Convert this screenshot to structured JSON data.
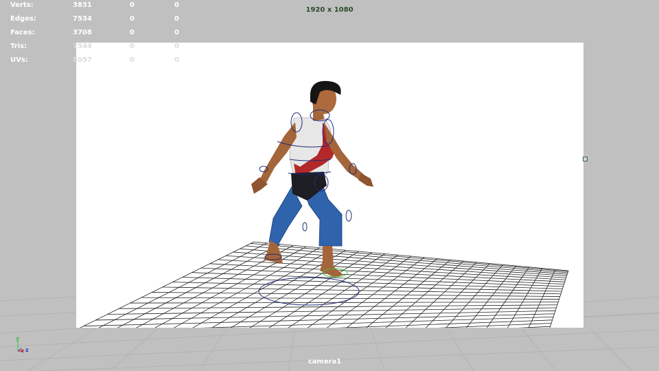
{
  "hud": {
    "rows": [
      {
        "label": "Verts:",
        "v1": "3831",
        "v2": "0",
        "v3": "0"
      },
      {
        "label": "Edges:",
        "v1": "7534",
        "v2": "0",
        "v3": "0"
      },
      {
        "label": "Faces:",
        "v1": "3708",
        "v2": "0",
        "v3": "0"
      },
      {
        "label": "Tris:",
        "v1": "7544",
        "v2": "0",
        "v3": "0"
      },
      {
        "label": "UVs:",
        "v1": "8057",
        "v2": "0",
        "v3": "0"
      }
    ]
  },
  "resolution_label": "1920 x 1080",
  "camera_label": "camera1",
  "axis": {
    "y": "y",
    "x": "x",
    "z": "z"
  },
  "colors": {
    "viewport_bg": "#c0c0c0",
    "gate_bg": "#ffffff",
    "grid_line": "#1e1e1e",
    "controls": "#1f2a78",
    "foot_control": "#3fbf3f"
  },
  "icons": [
    "axis-gizmo-icon",
    "gate-resize-handle-icon"
  ]
}
